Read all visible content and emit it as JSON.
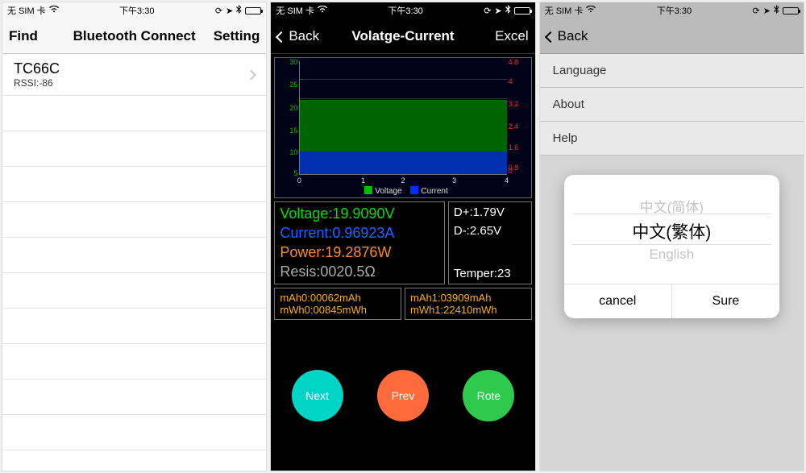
{
  "status_bar": {
    "carrier": "无 SIM 卡",
    "time": "下午3:30"
  },
  "screen1": {
    "nav_left": "Find",
    "nav_title": "Bluetooth Connect",
    "nav_right": "Setting",
    "device_name": "TC66C",
    "device_rssi": "RSSI:-86"
  },
  "screen2": {
    "nav_back": "Back",
    "nav_title": "Volatge-Current",
    "nav_right": "Excel",
    "chart_data": {
      "type": "area",
      "x": [
        0,
        1,
        2,
        3,
        4
      ],
      "series": [
        {
          "name": "Voltage",
          "color": "#00c000",
          "axis": "left",
          "value_constant": 19.9
        },
        {
          "name": "Current",
          "color": "#0030ff",
          "axis": "right",
          "value_constant": 0.97
        }
      ],
      "y_left": {
        "label": "Voltage",
        "ticks": [
          5.0,
          10.0,
          15.0,
          20.0,
          25.0,
          30.0
        ],
        "range": [
          0,
          30
        ]
      },
      "y_right": {
        "label": "Current",
        "ticks": [
          0.0,
          0.8,
          1.6,
          2.4,
          3.2,
          4.0,
          4.8
        ],
        "range": [
          0,
          4.8
        ]
      },
      "legend": [
        "Voltage",
        "Current"
      ]
    },
    "readings": {
      "voltage_label": "Voltage:",
      "voltage_value": "19.9090V",
      "current_label": "Current:",
      "current_value": "0.96923A",
      "power_label": "Power:",
      "power_value": "19.2876W",
      "resis_label": "Resis:",
      "resis_value": "0020.5Ω",
      "dplus": "D+:1.79V",
      "dminus": "D-:2.65V",
      "temper": "Temper:23"
    },
    "accum": {
      "mah0": "mAh0:00062mAh",
      "mwh0": "mWh0:00845mWh",
      "mah1": "mAh1:03909mAh",
      "mwh1": "mWh1:22410mWh"
    },
    "buttons": {
      "next": "Next",
      "prev": "Prev",
      "rote": "Rote"
    }
  },
  "screen3": {
    "nav_back": "Back",
    "items": {
      "language": "Language",
      "about": "About",
      "help": "Help"
    },
    "dialog": {
      "options": [
        "中文(简体)",
        "中文(繁体)",
        "English"
      ],
      "selected_index": 1,
      "cancel": "cancel",
      "sure": "Sure"
    }
  }
}
